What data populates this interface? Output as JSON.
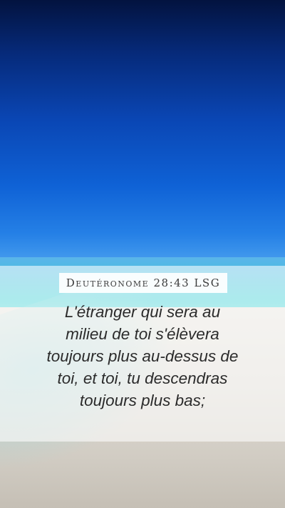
{
  "reference": "Deutéronome 28:43 LSG",
  "verse_text": "L'étranger qui sera au\nmilieu de toi s'élèvera\ntoujours plus au-dessus de\ntoi, et toi, tu descendras\ntoujours plus bas;",
  "colors": {
    "sky_top": "#03133f",
    "sky_bottom": "#4aa0ef",
    "sea": "#39cfd3",
    "sand": "#ddd9d1",
    "text": "#2b2b2b"
  }
}
